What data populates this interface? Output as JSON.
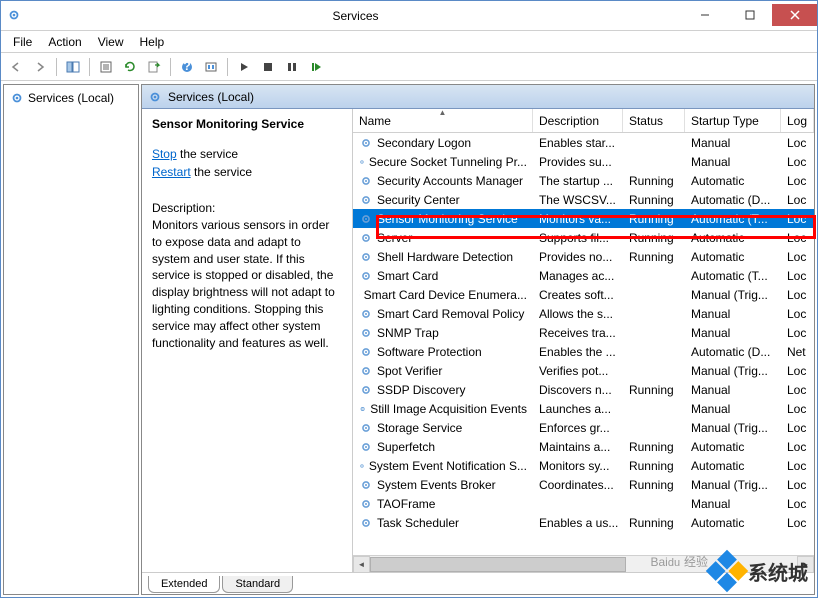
{
  "window": {
    "title": "Services"
  },
  "menu": {
    "file": "File",
    "action": "Action",
    "view": "View",
    "help": "Help"
  },
  "tree": {
    "root": "Services (Local)"
  },
  "pane": {
    "header": "Services (Local)"
  },
  "detail": {
    "title": "Sensor Monitoring Service",
    "stop": "Stop",
    "stop_suffix": " the service",
    "restart": "Restart",
    "restart_suffix": " the service",
    "desc_label": "Description:",
    "desc": "Monitors various sensors in order to expose data and adapt to system and user state.  If this service is stopped or disabled, the display brightness will not adapt to lighting conditions. Stopping this service may affect other system functionality and features as well."
  },
  "columns": {
    "name": "Name",
    "description": "Description",
    "status": "Status",
    "startup": "Startup Type",
    "logon": "Log"
  },
  "rows": [
    {
      "name": "Secondary Logon",
      "desc": "Enables star...",
      "status": "",
      "startup": "Manual",
      "logon": "Loc"
    },
    {
      "name": "Secure Socket Tunneling Pr...",
      "desc": "Provides su...",
      "status": "",
      "startup": "Manual",
      "logon": "Loc"
    },
    {
      "name": "Security Accounts Manager",
      "desc": "The startup ...",
      "status": "Running",
      "startup": "Automatic",
      "logon": "Loc"
    },
    {
      "name": "Security Center",
      "desc": "The WSCSV...",
      "status": "Running",
      "startup": "Automatic (D...",
      "logon": "Loc"
    },
    {
      "name": "Sensor Monitoring Service",
      "desc": "Monitors va...",
      "status": "Running",
      "startup": "Automatic (T...",
      "logon": "Loc",
      "selected": true
    },
    {
      "name": "Server",
      "desc": "Supports fil...",
      "status": "Running",
      "startup": "Automatic",
      "logon": "Loc"
    },
    {
      "name": "Shell Hardware Detection",
      "desc": "Provides no...",
      "status": "Running",
      "startup": "Automatic",
      "logon": "Loc"
    },
    {
      "name": "Smart Card",
      "desc": "Manages ac...",
      "status": "",
      "startup": "Automatic (T...",
      "logon": "Loc"
    },
    {
      "name": "Smart Card Device Enumera...",
      "desc": "Creates soft...",
      "status": "",
      "startup": "Manual (Trig...",
      "logon": "Loc"
    },
    {
      "name": "Smart Card Removal Policy",
      "desc": "Allows the s...",
      "status": "",
      "startup": "Manual",
      "logon": "Loc"
    },
    {
      "name": "SNMP Trap",
      "desc": "Receives tra...",
      "status": "",
      "startup": "Manual",
      "logon": "Loc"
    },
    {
      "name": "Software Protection",
      "desc": "Enables the ...",
      "status": "",
      "startup": "Automatic (D...",
      "logon": "Net"
    },
    {
      "name": "Spot Verifier",
      "desc": "Verifies pot...",
      "status": "",
      "startup": "Manual (Trig...",
      "logon": "Loc"
    },
    {
      "name": "SSDP Discovery",
      "desc": "Discovers n...",
      "status": "Running",
      "startup": "Manual",
      "logon": "Loc"
    },
    {
      "name": "Still Image Acquisition Events",
      "desc": "Launches a...",
      "status": "",
      "startup": "Manual",
      "logon": "Loc"
    },
    {
      "name": "Storage Service",
      "desc": "Enforces gr...",
      "status": "",
      "startup": "Manual (Trig...",
      "logon": "Loc"
    },
    {
      "name": "Superfetch",
      "desc": "Maintains a...",
      "status": "Running",
      "startup": "Automatic",
      "logon": "Loc"
    },
    {
      "name": "System Event Notification S...",
      "desc": "Monitors sy...",
      "status": "Running",
      "startup": "Automatic",
      "logon": "Loc"
    },
    {
      "name": "System Events Broker",
      "desc": "Coordinates...",
      "status": "Running",
      "startup": "Manual (Trig...",
      "logon": "Loc"
    },
    {
      "name": "TAOFrame",
      "desc": "",
      "status": "",
      "startup": "Manual",
      "logon": "Loc"
    },
    {
      "name": "Task Scheduler",
      "desc": "Enables a us...",
      "status": "Running",
      "startup": "Automatic",
      "logon": "Loc"
    }
  ],
  "tabs": {
    "extended": "Extended",
    "standard": "Standard"
  },
  "watermark": {
    "baidu": "Bai",
    "baidu2": "经验",
    "text": "系统城"
  },
  "colwidths": {
    "name": 180,
    "desc": 90,
    "status": 62,
    "startup": 96,
    "logon": 30
  }
}
